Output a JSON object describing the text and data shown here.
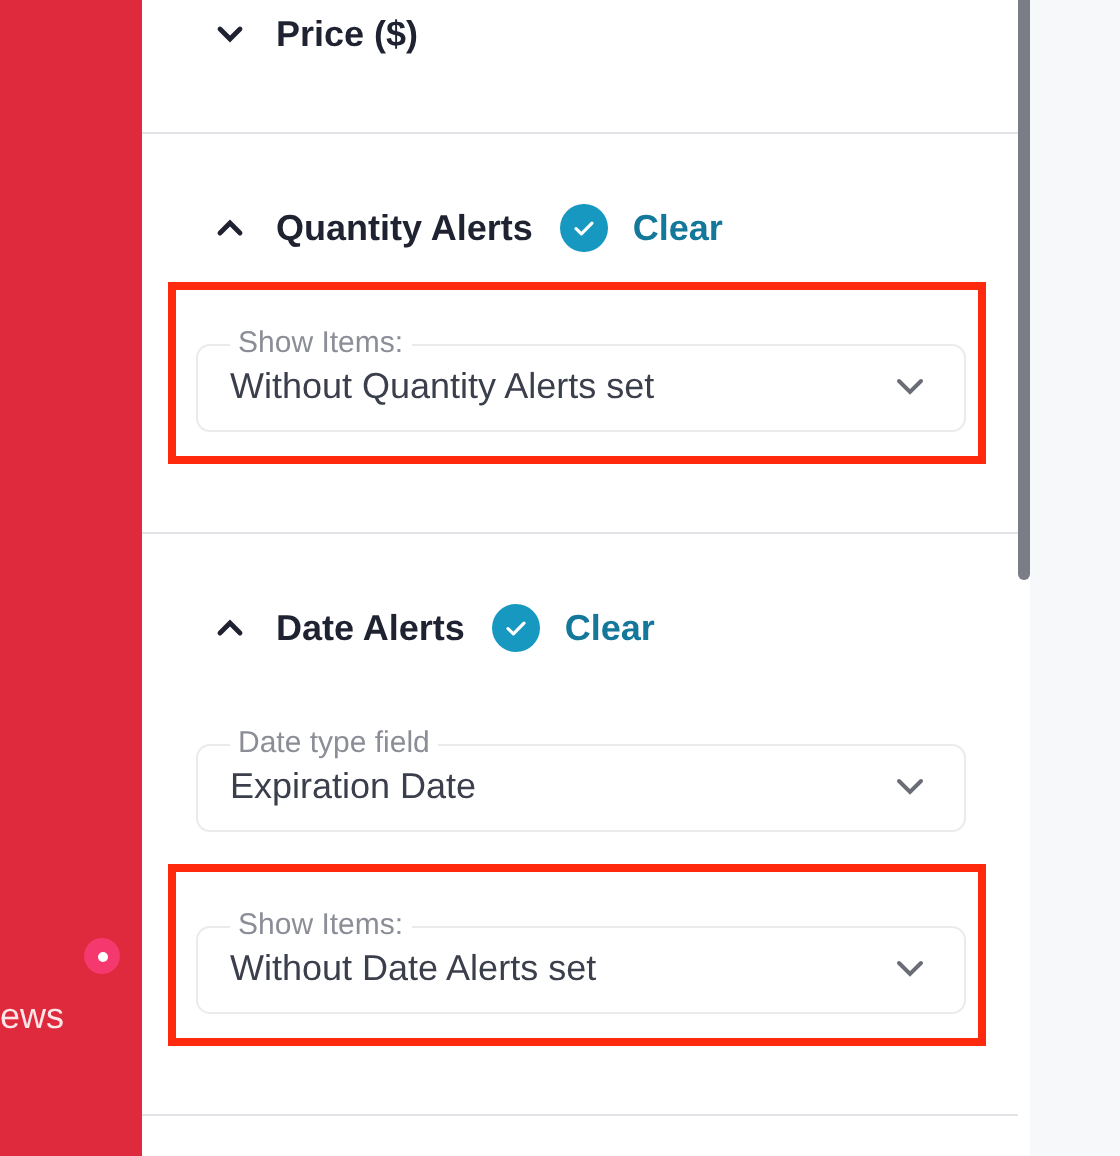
{
  "sidebar": {
    "label": "ews",
    "notification": true
  },
  "sections": [
    {
      "title": "Price ($)",
      "expanded": false
    },
    {
      "title": "Quantity Alerts",
      "expanded": true,
      "applied": true,
      "clear": "Clear",
      "fields": [
        {
          "label": "Show Items:",
          "value": "Without Quantity Alerts set",
          "highlighted": true
        }
      ]
    },
    {
      "title": "Date Alerts",
      "expanded": true,
      "applied": true,
      "clear": "Clear",
      "fields": [
        {
          "label": "Date type field",
          "value": "Expiration Date",
          "highlighted": false
        },
        {
          "label": "Show Items:",
          "value": "Without Date Alerts set",
          "highlighted": true
        }
      ]
    }
  ]
}
